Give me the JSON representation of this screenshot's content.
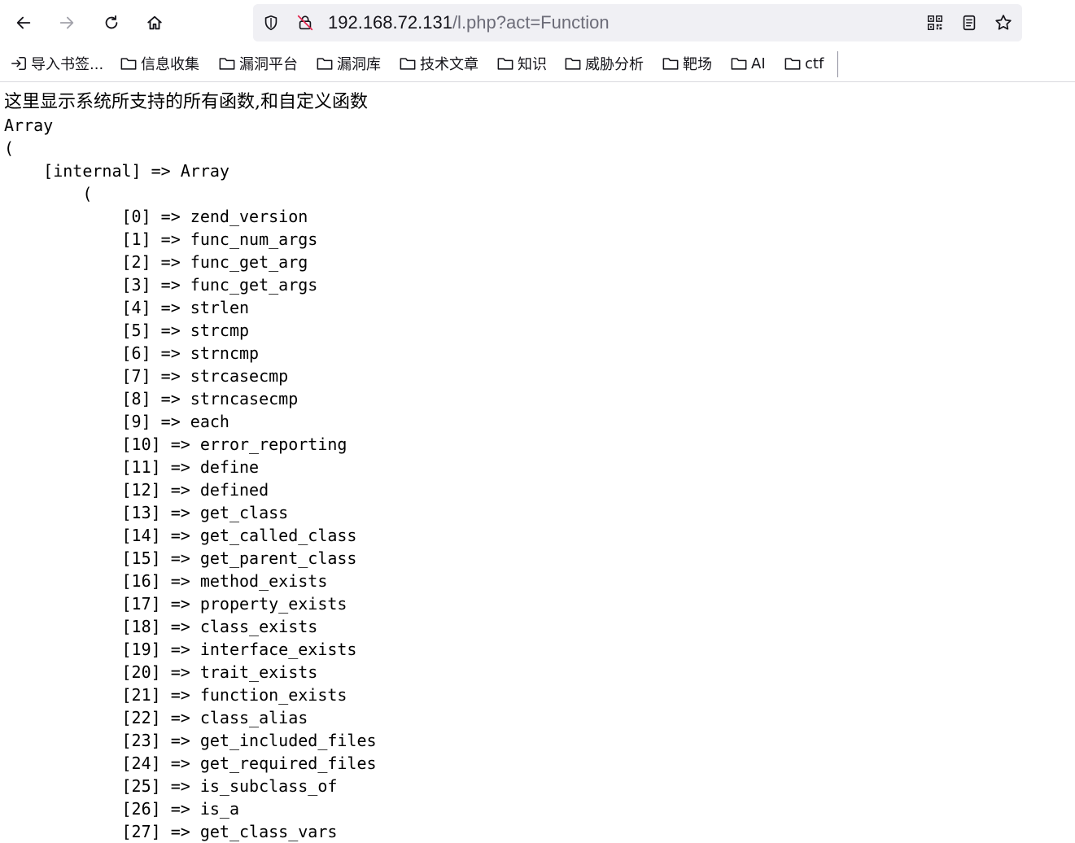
{
  "browser": {
    "url_host": "192.168.72.131",
    "url_path": "/l.php?act=Function",
    "bookmarks": [
      {
        "label": "导入书签...",
        "icon": "import-icon"
      },
      {
        "label": "信息收集",
        "icon": "folder-icon"
      },
      {
        "label": "漏洞平台",
        "icon": "folder-icon"
      },
      {
        "label": "漏洞库",
        "icon": "folder-icon"
      },
      {
        "label": "技术文章",
        "icon": "folder-icon"
      },
      {
        "label": "知识",
        "icon": "folder-icon"
      },
      {
        "label": "威胁分析",
        "icon": "folder-icon"
      },
      {
        "label": "靶场",
        "icon": "folder-icon"
      },
      {
        "label": "AI",
        "icon": "folder-icon"
      },
      {
        "label": "ctf",
        "icon": "folder-icon"
      }
    ]
  },
  "page": {
    "heading": "这里显示系统所支持的所有函数,和自定义函数",
    "dump_lines": [
      "Array",
      "(",
      "    [internal] => Array",
      "        (",
      "            [0] => zend_version",
      "            [1] => func_num_args",
      "            [2] => func_get_arg",
      "            [3] => func_get_args",
      "            [4] => strlen",
      "            [5] => strcmp",
      "            [6] => strncmp",
      "            [7] => strcasecmp",
      "            [8] => strncasecmp",
      "            [9] => each",
      "            [10] => error_reporting",
      "            [11] => define",
      "            [12] => defined",
      "            [13] => get_class",
      "            [14] => get_called_class",
      "            [15] => get_parent_class",
      "            [16] => method_exists",
      "            [17] => property_exists",
      "            [18] => class_exists",
      "            [19] => interface_exists",
      "            [20] => trait_exists",
      "            [21] => function_exists",
      "            [22] => class_alias",
      "            [23] => get_included_files",
      "            [24] => get_required_files",
      "            [25] => is_subclass_of",
      "            [26] => is_a",
      "            [27] => get_class_vars"
    ]
  }
}
